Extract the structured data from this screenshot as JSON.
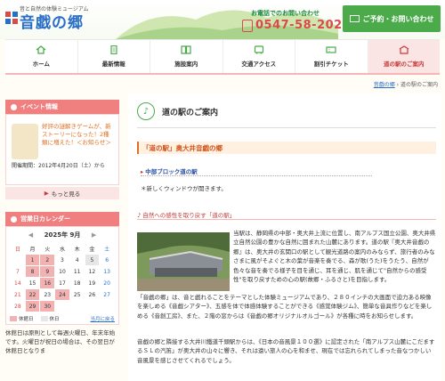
{
  "header": {
    "tagline": "音と自然の体験ミュージアム",
    "logo": "音戯の郷",
    "contact_note": "お電話でのお問い合わせ",
    "phone": "0547-58-2021",
    "reserve_button": "ご予約・お問い合わせ"
  },
  "nav": [
    {
      "label": "ホーム",
      "icon": "house-icon"
    },
    {
      "label": "最新情報",
      "icon": "document-icon"
    },
    {
      "label": "施設案内",
      "icon": "book-icon"
    },
    {
      "label": "交通アクセス",
      "icon": "bus-icon"
    },
    {
      "label": "割引チケット",
      "icon": "ticket-icon"
    },
    {
      "label": "道の駅のご案内",
      "icon": "station-icon"
    }
  ],
  "breadcrumb": {
    "home": "音戯の郷",
    "sep": "›",
    "current": "道の駅のご案内"
  },
  "sidebar": {
    "event_heading": "イベント情報",
    "event_title": "好評の謎解きゲームが、新ストーリーになった！2種類に増えた！＜お知らせ＞",
    "event_date": "開催期間：2012年4月20日（土）から",
    "more": "もっと見る",
    "calendar_heading": "営業日カレンダー",
    "calendar_title": "2025年 9月",
    "weekdays": [
      "日",
      "月",
      "火",
      "水",
      "木",
      "金",
      "土"
    ],
    "weeks": [
      [
        "",
        "1",
        "2",
        "3",
        "4",
        "5",
        "6"
      ],
      [
        "7",
        "8",
        "9",
        "10",
        "11",
        "12",
        "13"
      ],
      [
        "14",
        "15",
        "16",
        "17",
        "18",
        "19",
        "20"
      ],
      [
        "21",
        "22",
        "23",
        "24",
        "25",
        "26",
        "27"
      ],
      [
        "28",
        "29",
        "30",
        "",
        "",
        "",
        ""
      ]
    ],
    "closed_days": [
      "1",
      "2",
      "8",
      "9",
      "16",
      "22",
      "24",
      "29",
      "30"
    ],
    "special_days": [
      "5"
    ],
    "legend_closed": "休館日",
    "legend_special": "休日",
    "calendar_link": "当月に戻る",
    "note": "休館日は原則として毎週火曜日、年末年始です。火曜日が祝日の場合は、その翌日が休館日となりま"
  },
  "main": {
    "title": "道の駅のご案内",
    "section_title": "「道の駅」奥大井音戯の郷",
    "sub_heading": "中部ブロック道の駅",
    "sub_note": "＊新しくウィンドウが開きます。",
    "section2": "♪ 自然への感性を取り戻す「道の駅」",
    "para1": "当駅は、静岡県の中部・奥大井上流に位置し、南アルプス国立公園、奥大井県立自然公園の豊かな自然に囲まれた山麓にあります。道の駅『奥大井音戯の郷』は、奥大井の玄関口の駅として観光道路の案内のみならず、旅行者のみなさまに風がそよぐと木の葉が音楽を奏でる、森が歌(うた)をうたう、自然が色々な音を奏でる様子を目を通じ、耳を通じ、肌を通じて\"自然からの感受性\"を取り戻すための心の駅(故郷・ふるさと)を目指します。",
    "para2": "「音戯の郷」は、音と戯れることをテーマとした体験ミュージアムであり、２８０インチの大画面で迫力ある映像を楽しめる《音戯シアター》、五感を体で体感体験することができる《感覚体験ジム》、簡単な音具作りなどを楽しめる《音創工房》、また、２階の窓からは《音戯の郷オリジナルオルゴール》が各種に時をお知らせします。",
    "para3": "音戯の郷と隣接する大井川鐵道千頭駅からは、《日本の音風景１００選》に認定された「南アルプス山麓にこだまするＳＬの汽笛」が奥大井の山々に響き、それは遠い旅人の心を和ませ、現在では忘れられてしまった音なつかしい音風景を感じさせてくれるでしょう。"
  },
  "colors": {
    "accent": "#4bab4b",
    "pink": "#f08080",
    "brand": "#2a6fc7",
    "orange": "#e07020"
  }
}
